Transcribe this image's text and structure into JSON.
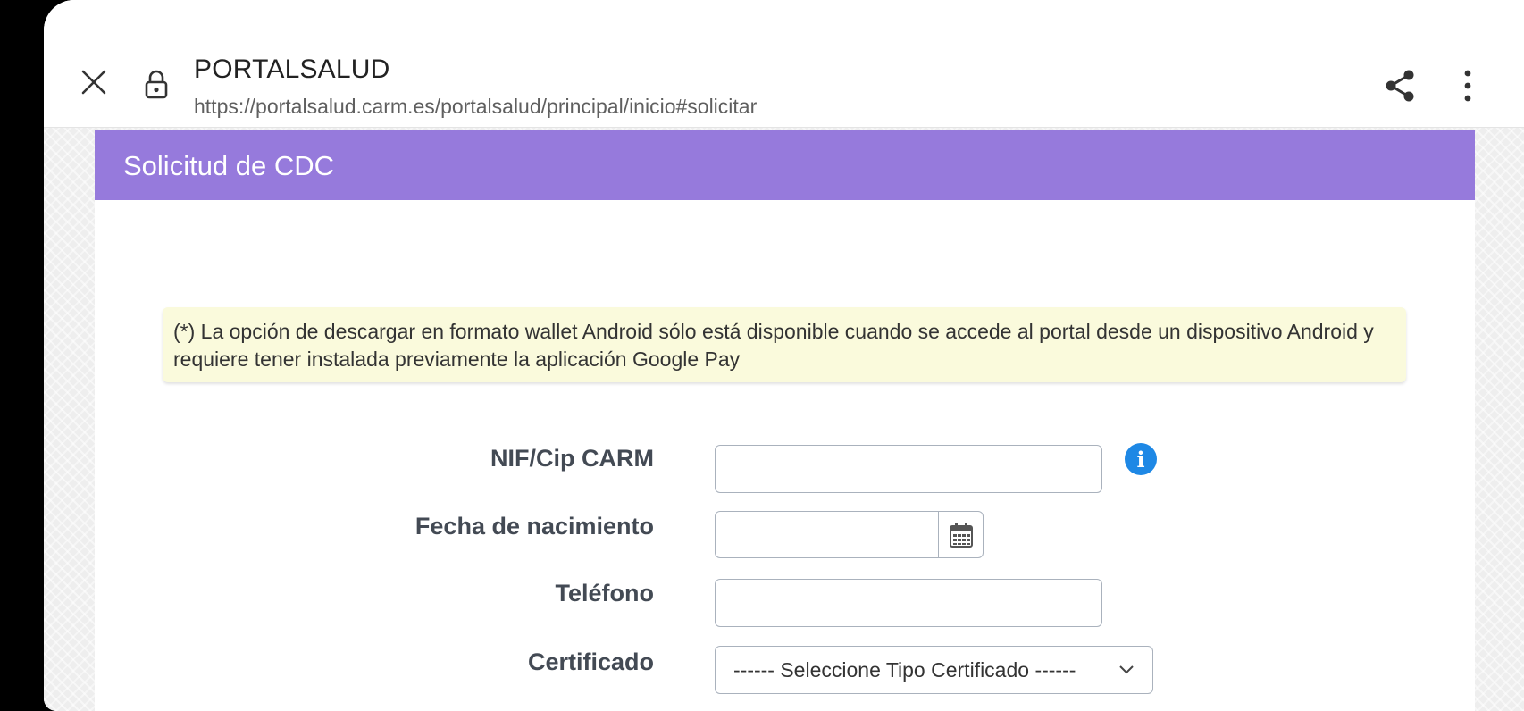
{
  "browser": {
    "title": "PORTALSALUD",
    "url": "https://portalsalud.carm.es/portalsalud/principal/inicio#solicitar",
    "icons": {
      "close": "close-icon",
      "lock": "lock-icon",
      "share": "share-icon",
      "more": "more-vertical-icon"
    }
  },
  "panel": {
    "title": "Solicitud de CDC",
    "header_color": "#967adc"
  },
  "notice": {
    "text": "(*) La opción de descargar en formato wallet Android sólo está disponible cuando se accede al portal desde un dispositivo Android y requiere tener instalada previamente la aplicación Google Pay",
    "background": "#fafadc"
  },
  "form": {
    "nif": {
      "label": "NIF/Cip CARM",
      "value": "",
      "placeholder": ""
    },
    "birthdate": {
      "label": "Fecha de nacimiento",
      "value": "",
      "placeholder": ""
    },
    "phone": {
      "label": "Teléfono",
      "value": "",
      "placeholder": ""
    },
    "certificate": {
      "label": "Certificado",
      "selected": "------ Seleccione Tipo Certificado ------"
    },
    "info_icon": "info-icon",
    "calendar_icon": "calendar-icon",
    "info_color": "#1e88e5"
  }
}
